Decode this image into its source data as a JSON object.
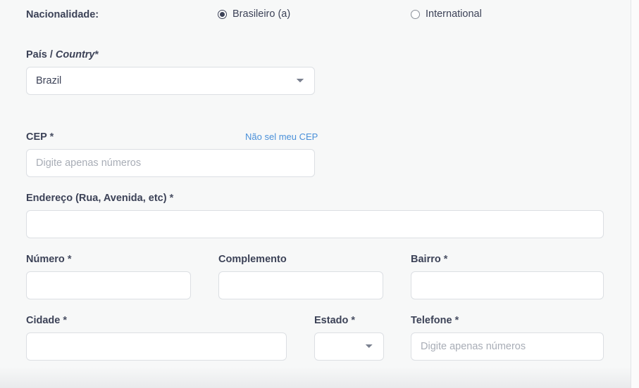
{
  "nationality": {
    "label": "Nacionalidade:",
    "options": [
      {
        "label": "Brasileiro (a)",
        "selected": true
      },
      {
        "label": "International",
        "selected": false
      }
    ]
  },
  "country": {
    "label_pt": "País /",
    "label_en": "Country",
    "required_mark": "*",
    "value": "Brazil",
    "options": [
      "Brazil"
    ]
  },
  "cep": {
    "label": "CEP",
    "required_mark": "*",
    "help_link": "Não sel meu CEP",
    "placeholder": "Digite apenas números",
    "value": ""
  },
  "address": {
    "label": "Endereço (Rua, Avenida, etc)",
    "required_mark": "*",
    "value": ""
  },
  "number": {
    "label": "Número",
    "required_mark": "*",
    "value": ""
  },
  "complement": {
    "label": "Complemento",
    "required_mark": "",
    "value": ""
  },
  "district": {
    "label": "Bairro",
    "required_mark": "*",
    "value": ""
  },
  "city": {
    "label": "Cidade",
    "required_mark": "*",
    "value": ""
  },
  "state": {
    "label": "Estado",
    "required_mark": "*",
    "value": "",
    "options": [
      ""
    ]
  },
  "phone": {
    "label": "Telefone",
    "required_mark": "*",
    "placeholder": "Digite apenas números",
    "value": ""
  },
  "colors": {
    "background": "#f7f8f8",
    "field_border": "#dcdfe3",
    "text": "#3c4257",
    "link": "#4a90d9",
    "placeholder": "#a8adb6"
  }
}
